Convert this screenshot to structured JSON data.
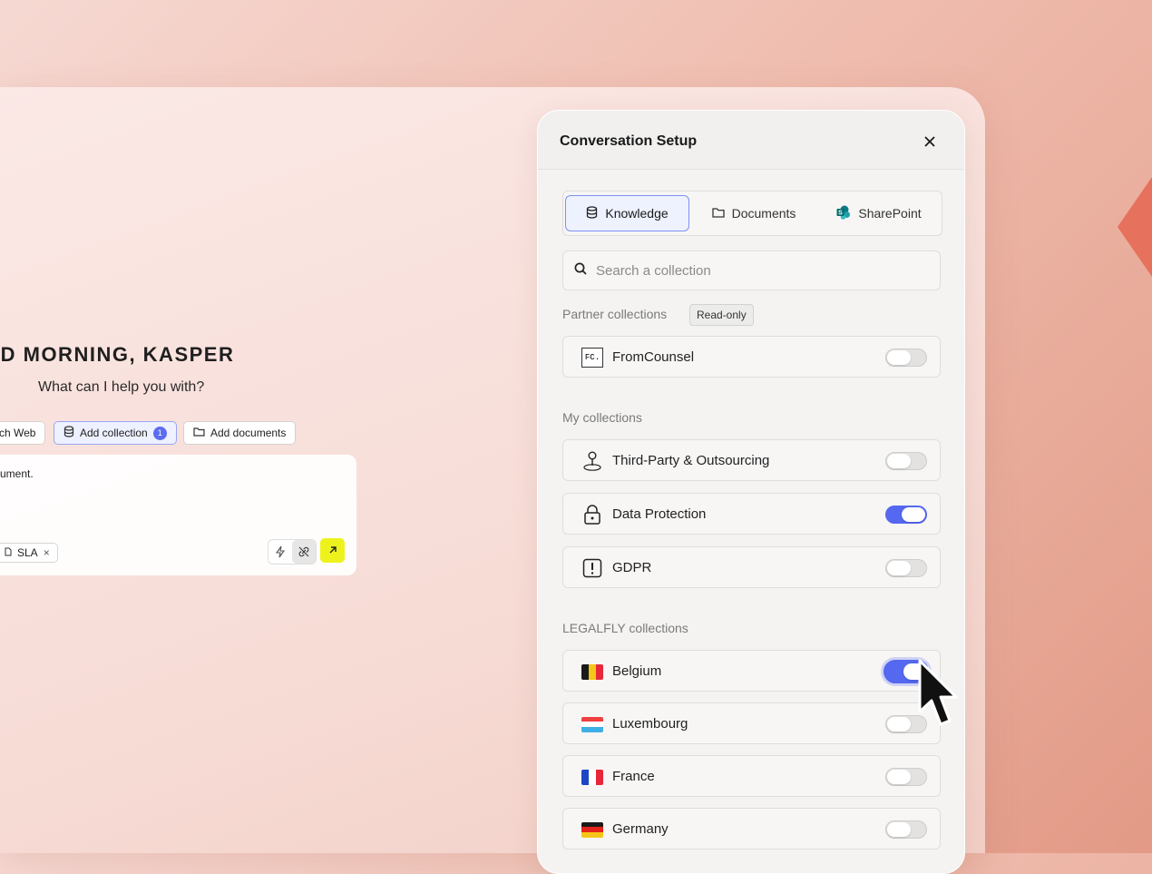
{
  "background": {
    "accent": "#e56a55"
  },
  "chat": {
    "greeting": "OD MORNING, KASPER",
    "subtitle": "What can I help you with?",
    "chips": [
      {
        "label": "ch Web",
        "icon": "globe-icon"
      },
      {
        "label": "Add collection",
        "icon": "database-icon",
        "count": "1"
      },
      {
        "label": "Add documents",
        "icon": "folder-icon"
      }
    ],
    "composer_text": "ument.",
    "attachment": {
      "label": "SLA",
      "icon": "document-icon",
      "remove": "×"
    },
    "tools": [
      {
        "icon": "lightning-icon"
      },
      {
        "icon": "no-link-icon"
      }
    ],
    "send": {
      "icon": "arrow-up-right-icon",
      "color": "#eef21c"
    }
  },
  "panel": {
    "title": "Conversation Setup",
    "close": "×",
    "tabs": [
      {
        "label": "Knowledge",
        "icon": "database-icon",
        "active": true
      },
      {
        "label": "Documents",
        "icon": "folder-icon",
        "active": false
      },
      {
        "label": "SharePoint",
        "icon": "sharepoint-icon",
        "active": false
      }
    ],
    "search": {
      "placeholder": "Search a collection",
      "value": ""
    },
    "partner": {
      "label": "Partner collections",
      "badge": "Read-only",
      "items": [
        {
          "label": "FromCounsel",
          "icon": "fromcounsel-logo-icon",
          "logo_text": "FC.",
          "enabled": false
        }
      ]
    },
    "mine": {
      "label": "My collections",
      "items": [
        {
          "label": "Third-Party & Outsourcing",
          "icon": "location-pin-icon",
          "enabled": false
        },
        {
          "label": "Data Protection",
          "icon": "lock-icon",
          "enabled": true
        },
        {
          "label": "GDPR",
          "icon": "alert-icon",
          "enabled": false
        }
      ]
    },
    "legalfly": {
      "label": "LEGALFLY collections",
      "items": [
        {
          "label": "Belgium",
          "icon": "belgium-flag-icon",
          "enabled": true
        },
        {
          "label": "Luxembourg",
          "icon": "luxembourg-flag-icon",
          "enabled": false
        },
        {
          "label": "France",
          "icon": "france-flag-icon",
          "enabled": false
        },
        {
          "label": "Germany",
          "icon": "germany-flag-icon",
          "enabled": false
        }
      ]
    },
    "toggle_on_color": "#5468f0"
  }
}
